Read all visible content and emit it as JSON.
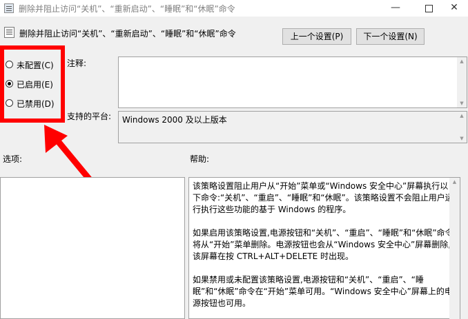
{
  "window": {
    "title": "删除并阻止访问“关机”、“重新启动”、“睡眠”和“休眠”命令",
    "minimize_glyph": "—",
    "close_glyph": "✕"
  },
  "policy": {
    "title": "删除并阻止访问“关机”、“重新启动”、“睡眠”和“休眠”命令"
  },
  "nav": {
    "prev_label": "上一个设置(P)",
    "next_label": "下一个设置(N)"
  },
  "state": {
    "options": [
      {
        "label": "未配置(C)",
        "selected": false
      },
      {
        "label": "已启用(E)",
        "selected": true
      },
      {
        "label": "已禁用(D)",
        "selected": false
      }
    ]
  },
  "labels": {
    "comment": "注释:",
    "platform": "支持的平台:",
    "options": "选项:",
    "help": "帮助:"
  },
  "comment_value": "",
  "platform_value": "Windows 2000 及以上版本",
  "help_text": [
    "该策略设置阻止用户从“开始”菜单或“Windows 安全中心”屏幕执行以下命令:“关机”、“重启”、“睡眠”和“休眠”。该策略设置不会阻止用户运行执行这些功能的基于 Windows 的程序。",
    "如果启用该策略设置,电源按钮和“关机”、“重启”、“睡眠”和“休眠”命令将从“开始”菜单删除。电源按钮也会从“Windows 安全中心”屏幕删除,该屏幕在按 CTRL+ALT+DELETE 时出现。",
    "如果禁用或未配置该策略设置,电源按钮和“关机”、“重启”、“睡眠”和“休眠”命令在“开始”菜单可用。“Windows 安全中心”屏幕上的电源按钮也可用。"
  ],
  "annotation": {
    "color": "#ff0000"
  }
}
